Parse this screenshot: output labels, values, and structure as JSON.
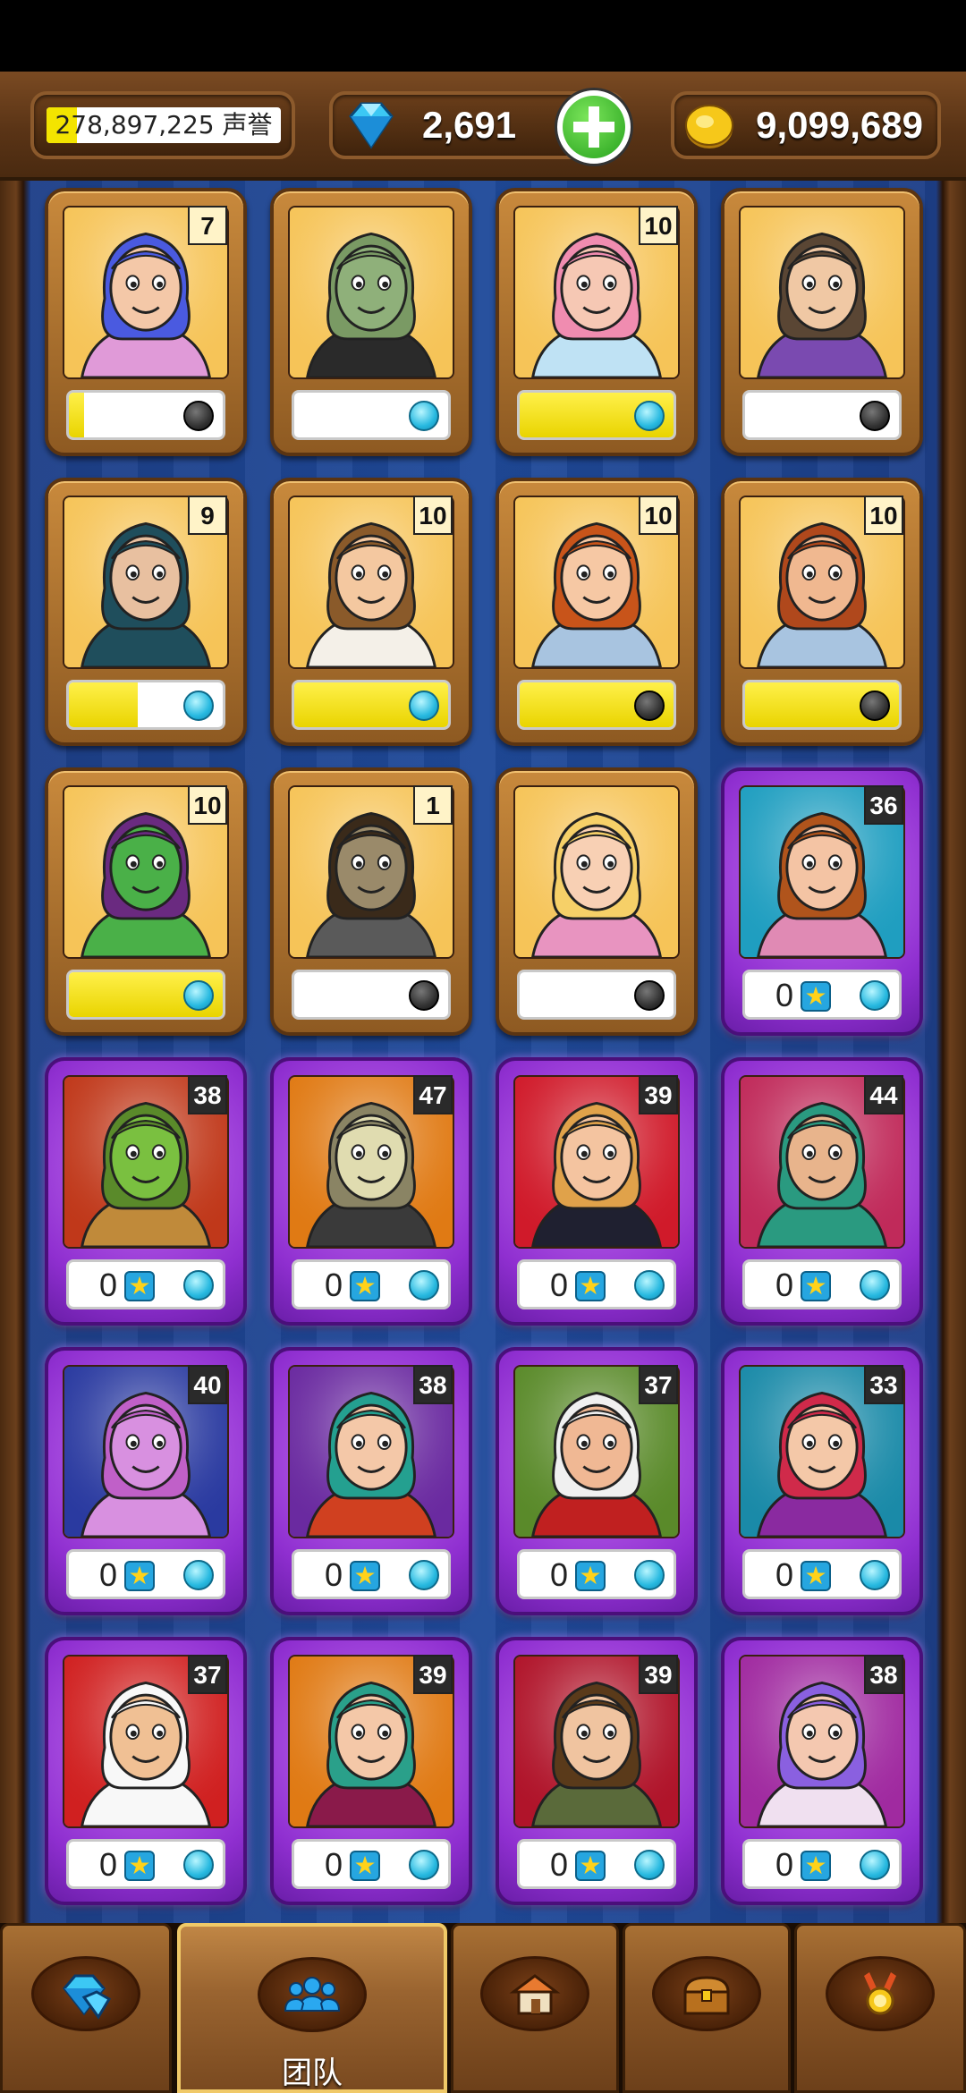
{
  "header": {
    "reputation": {
      "text": "278,897,225 声誉",
      "progress": 0.13
    },
    "gems": {
      "value": "2,691",
      "icon": "diamond-icon"
    },
    "add_gems_icon": "plus-icon",
    "coins": {
      "value": "9,099,689",
      "icon": "coin-icon"
    }
  },
  "cards": [
    {
      "id": "unicorn-girl",
      "rarity": "gold",
      "level": "7",
      "progress": 0.1,
      "dot": "off",
      "skin": "#f4c8a8",
      "hair": "#4a5ae0",
      "bg": "#f6c458",
      "cloth": "#e09ad8"
    },
    {
      "id": "orc-sunglasses",
      "rarity": "gold",
      "level": "",
      "progress": 0.0,
      "dot": "on",
      "skin": "#8fb07a",
      "hair": "#7a9a64",
      "bg": "#f6c458",
      "cloth": "#2a2a2a"
    },
    {
      "id": "crying-elf",
      "rarity": "gold",
      "level": "10",
      "progress": 1.0,
      "dot": "on",
      "skin": "#f6c8b4",
      "hair": "#f08cb0",
      "bg": "#f6c458",
      "cloth": "#bfe2f4"
    },
    {
      "id": "cat-lady",
      "rarity": "gold",
      "level": "",
      "progress": 0.0,
      "dot": "off",
      "skin": "#f0c8a4",
      "hair": "#5a4634",
      "bg": "#f6c458",
      "cloth": "#7a4ab0"
    },
    {
      "id": "ninja",
      "rarity": "gold",
      "level": "9",
      "progress": 0.45,
      "dot": "on",
      "skin": "#e8c0a0",
      "hair": "#1f4e5c",
      "bg": "#f6c458",
      "cloth": "#1f4e5c"
    },
    {
      "id": "scientist",
      "rarity": "gold",
      "level": "10",
      "progress": 1.0,
      "dot": "on",
      "skin": "#f4c8a0",
      "hair": "#8a5a2a",
      "bg": "#f6c458",
      "cloth": "#f4f0e8"
    },
    {
      "id": "curly-boy",
      "rarity": "gold",
      "level": "10",
      "progress": 1.0,
      "dot": "off",
      "skin": "#f6c8a4",
      "hair": "#c8541a",
      "bg": "#f6c458",
      "cloth": "#a8c4e0"
    },
    {
      "id": "bearded-man",
      "rarity": "gold",
      "level": "10",
      "progress": 1.0,
      "dot": "off",
      "skin": "#f0b890",
      "hair": "#b0481c",
      "bg": "#f6c458",
      "cloth": "#a8c4e0"
    },
    {
      "id": "goblin-keys",
      "rarity": "gold",
      "level": "10",
      "progress": 1.0,
      "dot": "on",
      "skin": "#4ab048",
      "hair": "#6a2a80",
      "bg": "#f6c458",
      "cloth": "#4ab048"
    },
    {
      "id": "zombie",
      "rarity": "gold",
      "level": "1",
      "progress": 0.0,
      "dot": "off",
      "skin": "#9a8a6a",
      "hair": "#3a2a1a",
      "bg": "#f6c458",
      "cloth": "#5a5a5a"
    },
    {
      "id": "blonde-girl",
      "rarity": "gold",
      "level": "",
      "progress": 0.0,
      "dot": "off",
      "skin": "#f8d0b4",
      "hair": "#f6d068",
      "bg": "#f6c458",
      "cloth": "#e894c0"
    },
    {
      "id": "flower-girl",
      "rarity": "purple",
      "level": "36",
      "stars": "0",
      "dot": "on",
      "skin": "#f4c4a4",
      "hair": "#b0541c",
      "bg": "#1f9ec0",
      "cloth": "#e08ab4"
    },
    {
      "id": "goblin-bat",
      "rarity": "purple",
      "level": "38",
      "stars": "0",
      "dot": "on",
      "skin": "#7ac040",
      "hair": "#5a8a2a",
      "bg": "#c0381a",
      "cloth": "#c08a3a"
    },
    {
      "id": "skeleton",
      "rarity": "purple",
      "level": "47",
      "stars": "0",
      "dot": "on",
      "skin": "#e0dcb0",
      "hair": "#8a8464",
      "bg": "#e07a14",
      "cloth": "#3a3a3a"
    },
    {
      "id": "mustache-man",
      "rarity": "purple",
      "level": "39",
      "stars": "0",
      "dot": "on",
      "skin": "#f4c4a0",
      "hair": "#e0a24a",
      "bg": "#d01a2a",
      "cloth": "#1f2030"
    },
    {
      "id": "sultan",
      "rarity": "purple",
      "level": "44",
      "stars": "0",
      "dot": "on",
      "skin": "#e8b48c",
      "hair": "#2a9a80",
      "bg": "#c02a5a",
      "cloth": "#2a9a80"
    },
    {
      "id": "unicorn",
      "rarity": "purple",
      "level": "40",
      "stars": "0",
      "dot": "on",
      "skin": "#d890e0",
      "hair": "#c060c8",
      "bg": "#2a3aa0",
      "cloth": "#d890e0"
    },
    {
      "id": "elf-green-hair",
      "rarity": "purple",
      "level": "38",
      "stars": "0",
      "dot": "on",
      "skin": "#f4c8a8",
      "hair": "#24a090",
      "bg": "#6a2aa0",
      "cloth": "#d04020"
    },
    {
      "id": "santa",
      "rarity": "purple",
      "level": "37",
      "stars": "0",
      "dot": "on",
      "skin": "#f0b894",
      "hair": "#f0f0f0",
      "bg": "#5a8a2a",
      "cloth": "#c02020"
    },
    {
      "id": "potion-elf",
      "rarity": "purple",
      "level": "33",
      "stars": "0",
      "dot": "on",
      "skin": "#f4c8a8",
      "hair": "#d02a4a",
      "bg": "#1a8aa8",
      "cloth": "#8a2aa0"
    },
    {
      "id": "chef",
      "rarity": "purple",
      "level": "37",
      "stars": "0",
      "dot": "on",
      "skin": "#f0c094",
      "hair": "#f8f8f8",
      "bg": "#d02020",
      "cloth": "#f8f8f8"
    },
    {
      "id": "painter-elf",
      "rarity": "purple",
      "level": "39",
      "stars": "0",
      "dot": "on",
      "skin": "#f4c8a8",
      "hair": "#2aa08a",
      "bg": "#e07a14",
      "cloth": "#8a1a4a"
    },
    {
      "id": "ghost-boy",
      "rarity": "purple",
      "level": "39",
      "stars": "0",
      "dot": "on",
      "skin": "#f0c4a0",
      "hair": "#5a3a1a",
      "bg": "#b0142a",
      "cloth": "#5a6a3a"
    },
    {
      "id": "fairy",
      "rarity": "purple",
      "level": "38",
      "stars": "0",
      "dot": "on",
      "skin": "#f4c8b0",
      "hair": "#8a60e0",
      "bg": "#a02aa0",
      "cloth": "#f0e0f0"
    }
  ],
  "nav": [
    {
      "id": "gems",
      "icon": "gems-icon",
      "label": "",
      "active": false
    },
    {
      "id": "team",
      "icon": "team-icon",
      "label": "团队",
      "active": true
    },
    {
      "id": "buildings",
      "icon": "house-icon",
      "label": "",
      "active": false
    },
    {
      "id": "chest",
      "icon": "chest-icon",
      "label": "",
      "active": false
    },
    {
      "id": "achievements",
      "icon": "medal-icon",
      "label": "",
      "active": false
    }
  ]
}
